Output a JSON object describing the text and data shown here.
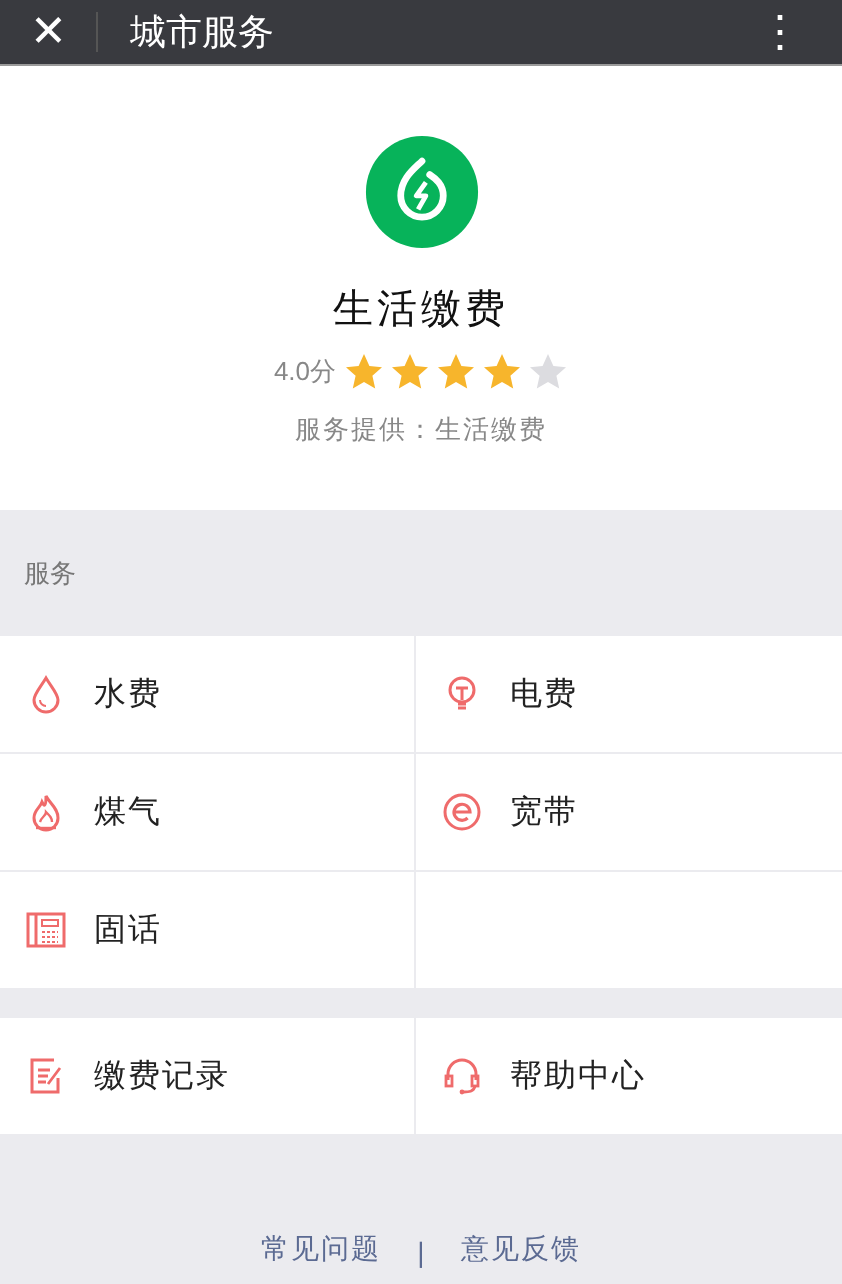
{
  "header": {
    "close": "✕",
    "title": "城市服务",
    "menu": "⋮"
  },
  "app": {
    "name": "生活缴费",
    "score": "4.0分",
    "stars": 4,
    "provider": "服务提供：生活缴费"
  },
  "section_label": "服务",
  "services": [
    {
      "kind": "water",
      "label": "水费"
    },
    {
      "kind": "electricity",
      "label": "电费"
    },
    {
      "kind": "gas",
      "label": "煤气"
    },
    {
      "kind": "broadband",
      "label": "宽带"
    },
    {
      "kind": "phone",
      "label": "固话"
    }
  ],
  "extras": [
    {
      "kind": "record",
      "label": "缴费记录"
    },
    {
      "kind": "help",
      "label": "帮助中心"
    }
  ],
  "footer": {
    "links": [
      "常见问题",
      "意见反馈"
    ],
    "separator": "|"
  }
}
